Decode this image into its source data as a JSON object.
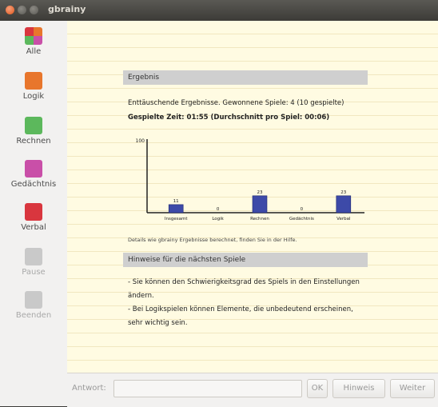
{
  "window": {
    "title": "gbrainy"
  },
  "sidebar": {
    "items": [
      {
        "label": "Alle",
        "icon": "all-games-icon",
        "color": "#e8762c"
      },
      {
        "label": "Logik",
        "icon": "logic-icon",
        "color": "#e8762c"
      },
      {
        "label": "Rechnen",
        "icon": "calculation-icon",
        "color": "#5cb85c"
      },
      {
        "label": "Gedächtnis",
        "icon": "memory-icon",
        "color": "#c94fa8"
      },
      {
        "label": "Verbal",
        "icon": "verbal-icon",
        "color": "#d9363e"
      },
      {
        "label": "Pause",
        "icon": "pause-icon",
        "color": "#b0b0b0"
      },
      {
        "label": "Beenden",
        "icon": "stop-icon",
        "color": "#b0b0b0"
      }
    ]
  },
  "results": {
    "header": "Ergebnis",
    "summary": "Enttäuschende Ergebnisse. Gewonnene Spiele: 4 (10 gespielte)",
    "time": "Gespielte Zeit: 01:55 (Durchschnitt pro Spiel: 00:06)",
    "footnote": "Details wie gbrainy Ergebnisse berechnet, finden Sie in der Hilfe."
  },
  "chart_data": {
    "type": "bar",
    "categories": [
      "Insgesamt",
      "Logik",
      "Rechnen",
      "Gedächtnis",
      "Verbal"
    ],
    "values": [
      11,
      0,
      23,
      0,
      23
    ],
    "value_labels": [
      "11",
      "0",
      "23",
      "0",
      "23"
    ],
    "y_tick_label": "100",
    "ylim": [
      0,
      100
    ],
    "bar_color": "#3d4aa8",
    "grid": false
  },
  "hints": {
    "header": "Hinweise für die nächsten Spiele",
    "line1": "- Sie können den Schwierigkeitsgrad des Spiels in den Einstellungen",
    "line2": "ändern.",
    "line3": "- Bei Logikspielen können Elemente, die unbedeutend erscheinen,",
    "line4": "sehr wichtig sein."
  },
  "bottom": {
    "answer_label": "Antwort:",
    "answer_value": "",
    "ok_label": "OK",
    "hint_label": "Hinweis",
    "next_label": "Weiter"
  }
}
